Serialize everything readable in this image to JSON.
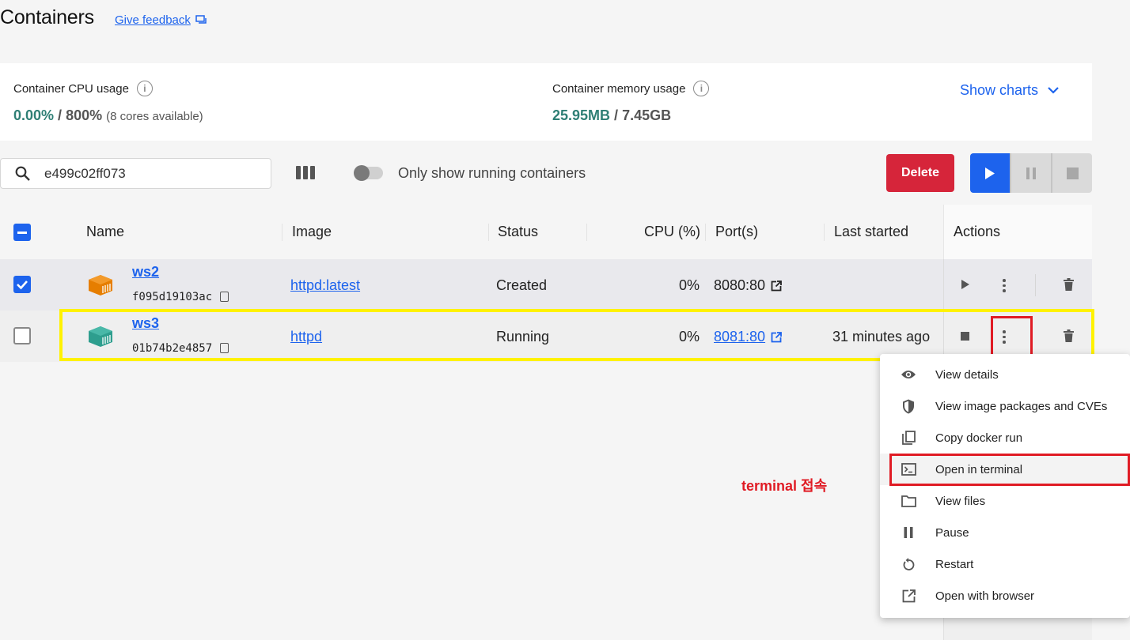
{
  "header": {
    "title": "Containers",
    "feedback_label": "Give feedback"
  },
  "usage": {
    "cpu_label": "Container CPU usage",
    "cpu_value": "0.00%",
    "cpu_sep": " / ",
    "cpu_total": "800%",
    "cpu_note": "(8 cores available)",
    "mem_label": "Container memory usage",
    "mem_value": "25.95MB",
    "mem_sep": " / ",
    "mem_total": "7.45GB",
    "show_charts": "Show charts"
  },
  "toolbar": {
    "search_value": "e499c02ff073",
    "only_running_label": "Only show running containers",
    "only_running_enabled": false,
    "delete_label": "Delete"
  },
  "table": {
    "headers": {
      "name": "Name",
      "image": "Image",
      "status": "Status",
      "cpu": "CPU (%)",
      "ports": "Port(s)",
      "last_started": "Last started",
      "actions": "Actions"
    },
    "rows": [
      {
        "checked": true,
        "name": "ws2",
        "id": "f095d19103ac",
        "image": "httpd:latest",
        "status": "Created",
        "cpu": "0%",
        "port": "8080:80",
        "last_started": "",
        "icon_color": "#e67e00"
      },
      {
        "checked": false,
        "name": "ws3",
        "id": "01b74b2e4857",
        "image": "httpd",
        "status": "Running",
        "cpu": "0%",
        "port": "8081:80",
        "last_started": "31 minutes ago",
        "icon_color": "#2e9e8e"
      }
    ]
  },
  "context_menu": {
    "items": [
      {
        "label": "View details",
        "icon": "eye-icon"
      },
      {
        "label": "View image packages and CVEs",
        "icon": "shield-icon"
      },
      {
        "label": "Copy docker run",
        "icon": "copy-icon"
      },
      {
        "label": "Open in terminal",
        "icon": "terminal-icon"
      },
      {
        "label": "View files",
        "icon": "folder-icon"
      },
      {
        "label": "Pause",
        "icon": "pause-icon"
      },
      {
        "label": "Restart",
        "icon": "restart-icon"
      },
      {
        "label": "Open with browser",
        "icon": "external-link-icon"
      }
    ]
  },
  "annotation": {
    "text": "terminal 접속"
  },
  "colors": {
    "accent": "#1d63ed",
    "danger": "#d6253a",
    "highlight_yellow": "#fff200",
    "highlight_red": "#e01b24",
    "usage_green": "#2f7f75"
  }
}
